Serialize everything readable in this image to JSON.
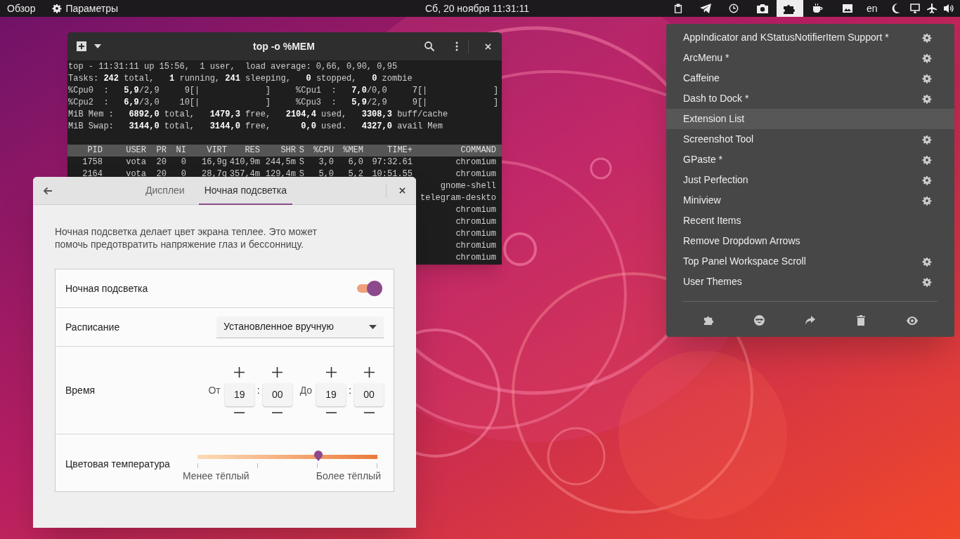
{
  "top_bar": {
    "activities": "Обзор",
    "app_menu": "Параметры",
    "clock": "Сб, 20 ноября  11:31:11",
    "keyboard_layout": "en",
    "extensions_indicator_active": true
  },
  "terminal": {
    "title": "top -o %MEM",
    "summary_lines": [
      "top - 11:31:11 up 15:56,  1 user,  load average: 0,66, 0,90, 0,95",
      "Tasks: **242** total,   **1** running, **241** sleeping,   **0** stopped,   **0** zombie",
      "%Cpu0  :   **5,9**/2,9     9[|             ]     %Cpu1  :   **7,0**/0,0     7[|             ]",
      "%Cpu2  :   **6,9**/3,0    10[|             ]     %Cpu3  :   **5,9**/2,9     9[|             ]",
      "MiB Mem :   **6892,0** total,   **1479,3** free,   **2104,4** used,   **3308,3** buff/cache",
      "MiB Swap:   **3144,0** total,   **3144,0** free,      **0,0** used.   **4327,0** avail Mem"
    ],
    "columns": [
      "PID",
      "USER",
      "PR",
      "NI",
      "VIRT",
      "RES",
      "SHR",
      "S",
      "%CPU",
      "%MEM",
      "TIME+",
      "COMMAND"
    ],
    "rows": [
      {
        "pid": "1758",
        "user": "vota",
        "pr": "20",
        "ni": "0",
        "virt": "16,9g",
        "res": "410,9m",
        "shr": "244,5m",
        "s": "S",
        "cpu": "3,0",
        "mem": "6,0",
        "time": "97:32.61",
        "command": "chromium"
      },
      {
        "pid": "2164",
        "user": "vota",
        "pr": "20",
        "ni": "0",
        "virt": "28,7g",
        "res": "357,4m",
        "shr": "129,4m",
        "s": "S",
        "cpu": "5,0",
        "mem": "5,2",
        "time": "10:51.55",
        "command": "chromium"
      },
      {
        "command": "gnome-shell"
      },
      {
        "command": "telegram-deskto"
      },
      {
        "command": "chromium"
      },
      {
        "command": "chromium"
      },
      {
        "command": "chromium"
      },
      {
        "command": "chromium"
      },
      {
        "command": "chromium"
      }
    ]
  },
  "settings": {
    "tabs": [
      {
        "label": "Дисплеи",
        "selected": false
      },
      {
        "label": "Ночная подсветка",
        "selected": true
      }
    ],
    "description": "Ночная подсветка делает цвет экрана теплее. Это может помочь предотвратить напряжение глаз и бессонницу.",
    "night_light": {
      "label": "Ночная подсветка",
      "on": true
    },
    "schedule": {
      "label": "Расписание",
      "value": "Установленное вручную"
    },
    "time": {
      "label": "Время",
      "parts": [
        {
          "kind": "label",
          "text": "От"
        },
        {
          "kind": "spin",
          "value": "19"
        },
        {
          "kind": "colon",
          "text": ":"
        },
        {
          "kind": "spin",
          "value": "00"
        },
        {
          "kind": "label",
          "text": "До"
        },
        {
          "kind": "spin",
          "value": "19"
        },
        {
          "kind": "colon",
          "text": ":"
        },
        {
          "kind": "spin",
          "value": "00"
        }
      ]
    },
    "temperature": {
      "label": "Цветовая температура",
      "level": 0.67,
      "min_label": "Менее тёплый",
      "max_label": "Более тёплый"
    }
  },
  "extensions_menu": {
    "items": [
      {
        "name": "AppIndicator and KStatusNotifierItem Support *",
        "has_settings": true,
        "selected": false
      },
      {
        "name": "ArcMenu *",
        "has_settings": true,
        "selected": false
      },
      {
        "name": "Caffeine",
        "has_settings": true,
        "selected": false
      },
      {
        "name": "Dash to Dock *",
        "has_settings": true,
        "selected": false
      },
      {
        "name": "Extension List",
        "has_settings": false,
        "selected": true
      },
      {
        "name": "Screenshot Tool",
        "has_settings": true,
        "selected": false
      },
      {
        "name": "GPaste *",
        "has_settings": true,
        "selected": false
      },
      {
        "name": "Just Perfection",
        "has_settings": true,
        "selected": false
      },
      {
        "name": "Miniview",
        "has_settings": true,
        "selected": false
      },
      {
        "name": "Recent Items",
        "has_settings": false,
        "selected": false
      },
      {
        "name": "Remove Dropdown Arrows",
        "has_settings": false,
        "selected": false
      },
      {
        "name": "Top Panel Workspace Scroll",
        "has_settings": true,
        "selected": false
      },
      {
        "name": "User Themes",
        "has_settings": true,
        "selected": false
      }
    ]
  }
}
